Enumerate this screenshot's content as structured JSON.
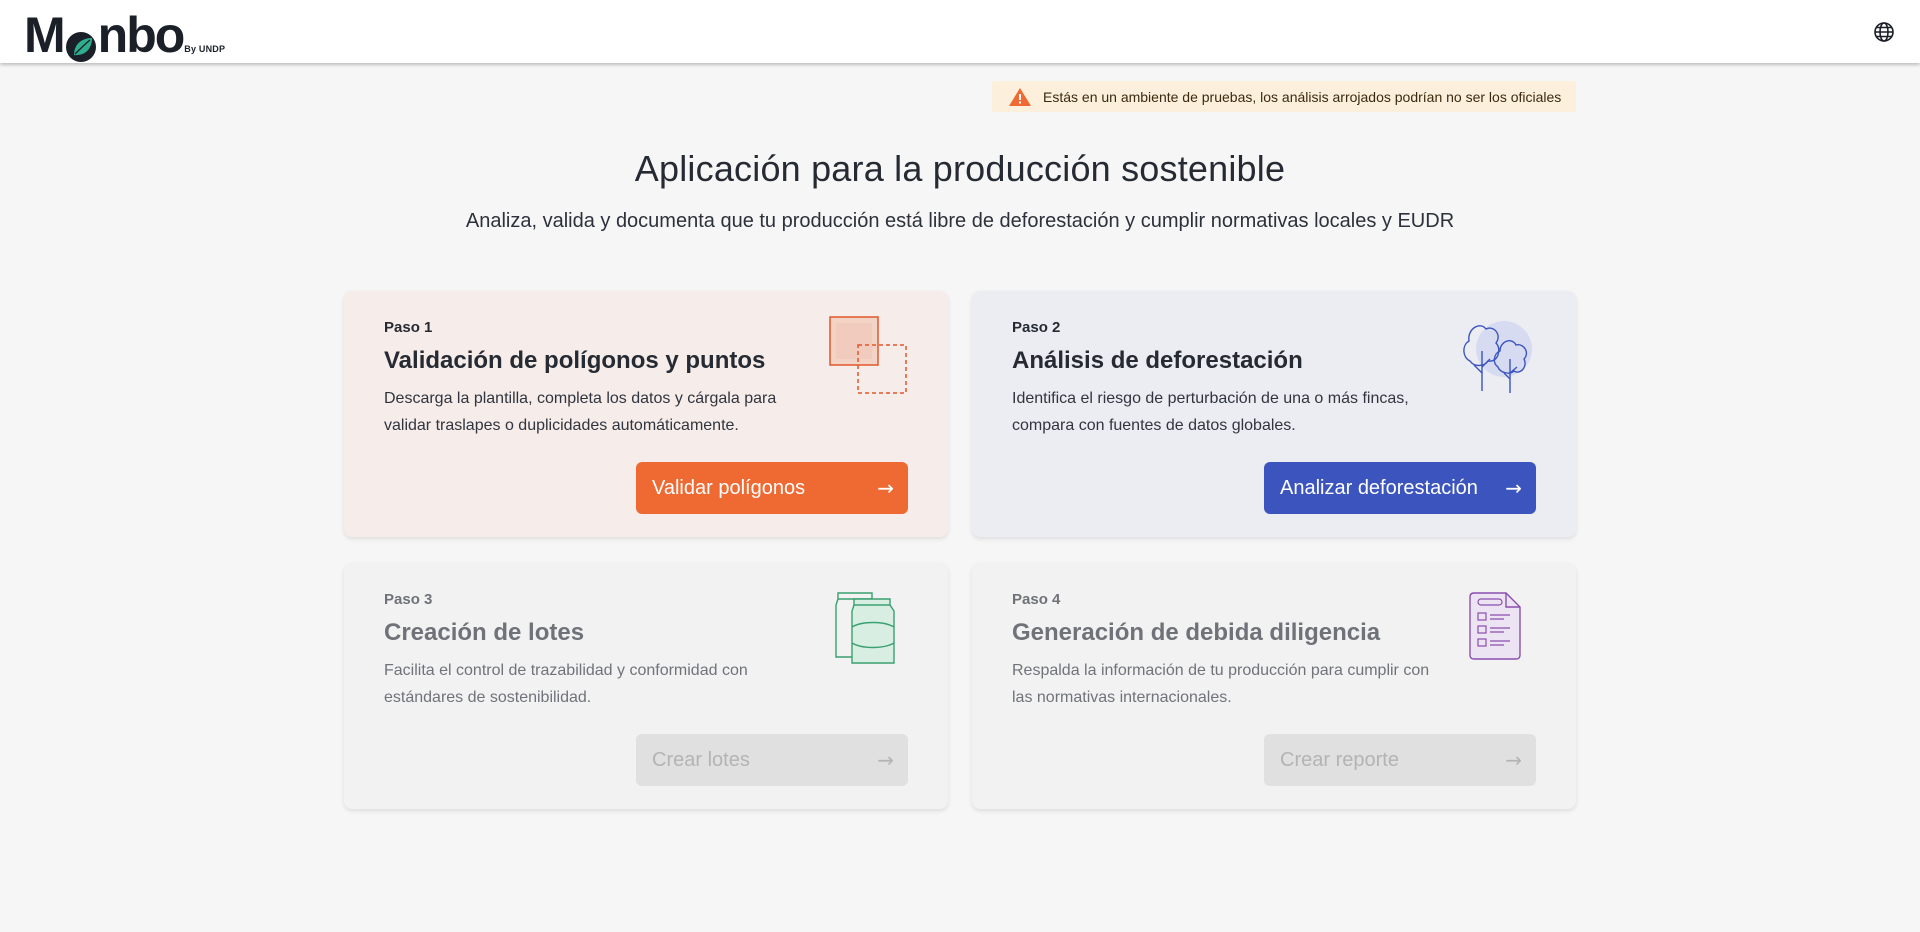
{
  "header": {
    "logo_text": "Mnbo",
    "logo_suffix": "By UNDP",
    "language_icon": "globe-icon"
  },
  "banner": {
    "icon": "warning-icon",
    "text": "Estás en un ambiente de pruebas, los análisis arrojados podrían no ser los oficiales",
    "color": "#ee6a32"
  },
  "hero": {
    "title": "Aplicación para la producción sostenible",
    "subtitle": "Analiza, valida y documenta que tu producción está libre de deforestación y cumplir normativas locales y EUDR"
  },
  "cards": [
    {
      "step": "Paso 1",
      "title": "Validación de polígonos y puntos",
      "description": "Descarga la plantilla, completa los datos y cárgala para validar traslapes o duplicidades automáticamente.",
      "button": "Validar polígonos",
      "arrow": "→",
      "icon": "polygons-icon",
      "enabled": true,
      "accent": "#ee6a32"
    },
    {
      "step": "Paso 2",
      "title": "Análisis de deforestación",
      "description": "Identifica el riesgo de perturbación de una o más fincas, compara con fuentes de datos globales.",
      "button": "Analizar deforestación",
      "arrow": "→",
      "icon": "trees-icon",
      "enabled": true,
      "accent": "#3c55be"
    },
    {
      "step": "Paso 3",
      "title": "Creación de lotes",
      "description": "Facilita el control de trazabilidad y conformidad con estándares de sostenibilidad.",
      "button": "Crear lotes",
      "arrow": "→",
      "icon": "bags-icon",
      "enabled": false,
      "accent": "#3aa070"
    },
    {
      "step": "Paso 4",
      "title": "Generación de debida diligencia",
      "description": "Respalda la información de tu producción para cumplir con las normativas internacionales.",
      "button": "Crear reporte",
      "arrow": "→",
      "icon": "checklist-icon",
      "enabled": false,
      "accent": "#8a4fb0"
    }
  ]
}
